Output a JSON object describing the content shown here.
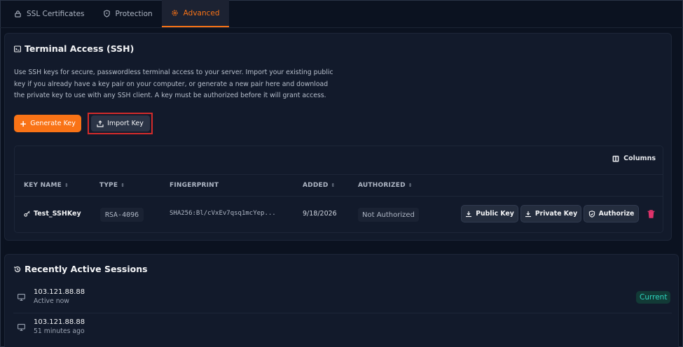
{
  "tabs": [
    {
      "label": "SSL Certificates",
      "icon": "lock-icon"
    },
    {
      "label": "Protection",
      "icon": "shield-icon"
    },
    {
      "label": "Advanced",
      "icon": "gear-icon"
    }
  ],
  "active_tab": "Advanced",
  "accent_color": "#f97316",
  "ssh": {
    "title": "Terminal Access (SSH)",
    "description": "Use SSH keys for secure, passwordless terminal access to your server. Import your existing public key if you already have a key pair on your computer, or generate a new pair here and download the private key to use with any SSH client. A key must be authorized before it will grant access.",
    "generate_label": "Generate Key",
    "import_label": "Import Key",
    "columns_label": "Columns",
    "headers": {
      "key_name": "KEY NAME",
      "type": "TYPE",
      "fingerprint": "FINGERPRINT",
      "added": "ADDED",
      "authorized": "AUTHORIZED"
    },
    "rows": [
      {
        "key_name": "Test_SSHKey",
        "type": "RSA-4096",
        "fingerprint": "SHA256:Bl/cVxEv7qsq1mcYep...",
        "added": "9/18/2026",
        "authorized": "Not Authorized"
      }
    ],
    "actions": {
      "public_key": "Public Key",
      "private_key": "Private Key",
      "authorize": "Authorize"
    }
  },
  "sessions": {
    "title": "Recently Active Sessions",
    "items": [
      {
        "ip": "103.121.88.88",
        "status": "Active now",
        "badge": "Current"
      },
      {
        "ip": "103.121.88.88",
        "status": "51 minutes ago"
      }
    ]
  }
}
